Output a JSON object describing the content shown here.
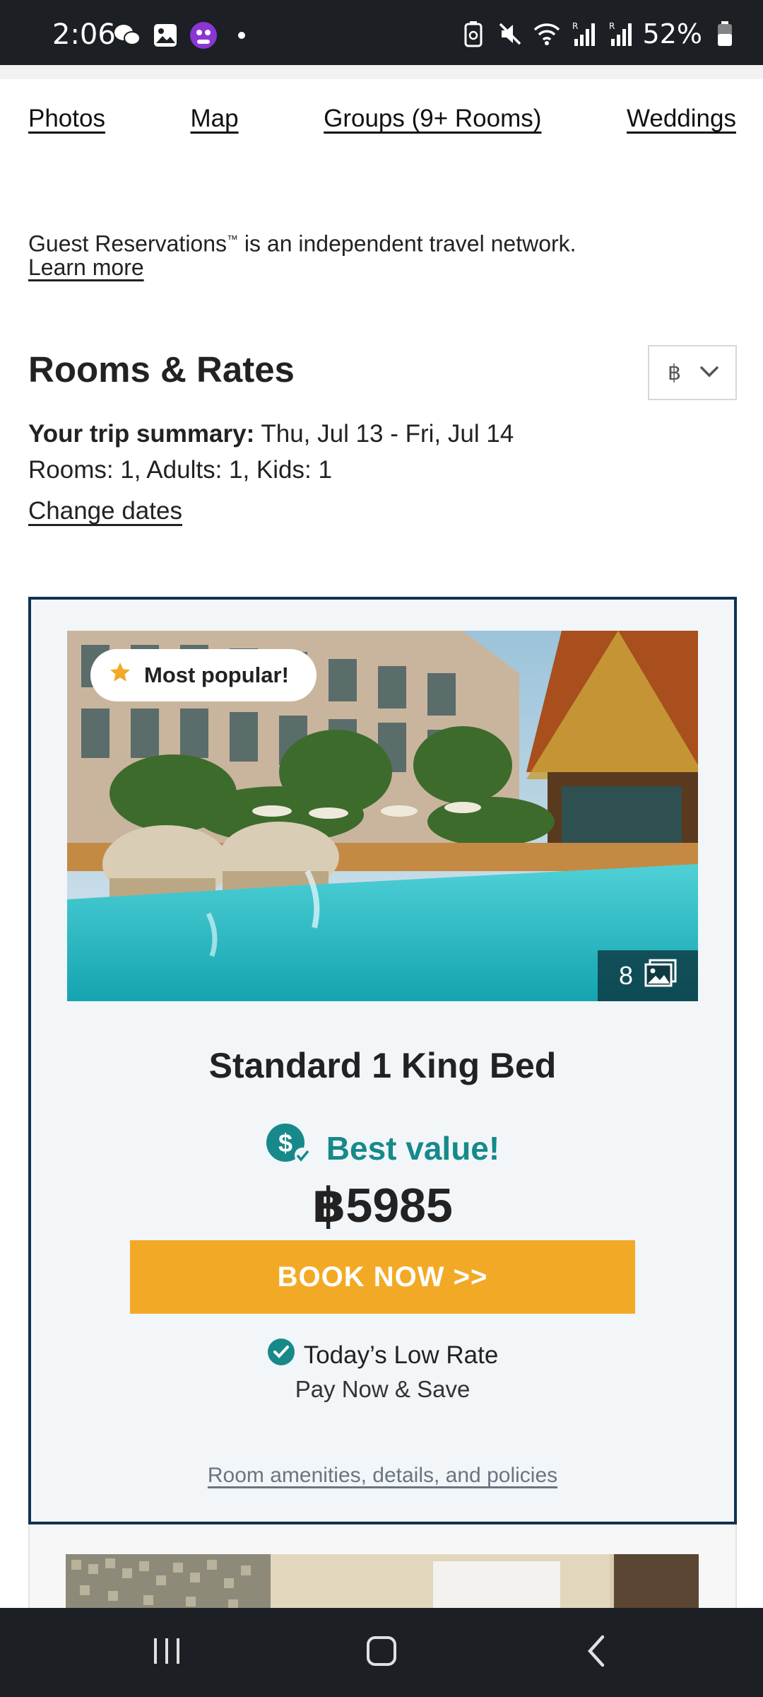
{
  "status_bar": {
    "time": "2:06",
    "battery": "52%",
    "left_icons": [
      "wechat-icon",
      "gallery-icon",
      "app-icon",
      "dot-icon"
    ],
    "right_icons": [
      "battery-saver-icon",
      "mute-icon",
      "wifi-icon",
      "signal-r-icon",
      "signal-r-icon",
      "battery-icon"
    ]
  },
  "top_nav": {
    "links": [
      "Photos",
      "Map",
      "Groups (9+ Rooms)",
      "Weddings"
    ]
  },
  "notice": {
    "text_before": "Guest Reservations",
    "tm": "™",
    "text_after": " is an independent travel network.",
    "learn_more": "Learn more"
  },
  "rates": {
    "title": "Rooms & Rates",
    "currency_symbol": "฿",
    "summary_label": "Your trip summary:",
    "summary_dates": "Thu, Jul 13 - Fri, Jul 14",
    "rooms_line": "Rooms: 1, Adults: 1, Kids: 1",
    "change_dates": "Change dates"
  },
  "room_card": {
    "badge": "Most popular!",
    "photo_count": "8",
    "room_name": "Standard 1 King Bed",
    "best_value": "Best value!",
    "price": "฿5985",
    "book_button": "BOOK NOW >>",
    "low_rate": "Today’s Low Rate",
    "pay_now": "Pay Now & Save",
    "amenities_link": "Room amenities, details, and policies"
  },
  "colors": {
    "accent_teal": "#17898a",
    "book_button": "#f2aa26",
    "card_border": "#0f3252",
    "card_bg": "#f2f6f9"
  },
  "nav_bar": {
    "buttons": [
      "recents-icon",
      "home-icon",
      "back-icon"
    ]
  }
}
